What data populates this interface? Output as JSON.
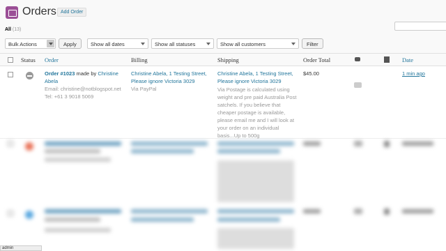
{
  "header": {
    "title": "Orders",
    "add_button": "Add Order"
  },
  "filters": {
    "all_label": "All",
    "all_count": "(13)",
    "bulk_actions": "Bulk Actions",
    "apply": "Apply",
    "dates": "Show all dates",
    "statuses": "Show all statuses",
    "customers": "Show all customers",
    "filter": "Filter"
  },
  "columns": {
    "status": "Status",
    "order": "Order",
    "billing": "Billing",
    "shipping": "Shipping",
    "total": "Order Total",
    "date": "Date"
  },
  "row": {
    "order_number": "Order #1023",
    "made_by": "made by",
    "customer_first": "Christine",
    "customer_last": "Abela",
    "email": "Email: christine@notblogspot.net",
    "tel": "Tel: +61 3 9018 5069",
    "billing_line1": "Christine Abela, 1 Testing Street,",
    "billing_line2": "Please ignore Victoria 3029",
    "billing_via": "Via PayPal",
    "shipping_line1": "Christine Abela, 1 Testing Street,",
    "shipping_line2": "Please ignore Victoria 3029",
    "shipping_note": [
      "Via Postage is calculated using",
      "weight and pre paid Australia Post",
      "satchels. If you believe that",
      "cheaper postage is available,",
      "please email me and I will look at",
      "your order on an individual",
      "basis...Up to 500g"
    ],
    "total": "$45.00",
    "date": "1 min ago"
  },
  "status_bar": "admin",
  "icons": {
    "page": "orders-icon",
    "status": "cancelled-icon",
    "comment": "comment-icon",
    "notes": "notes-icon"
  },
  "colors": {
    "link": "#21759b",
    "brand": "#9b4f96"
  }
}
